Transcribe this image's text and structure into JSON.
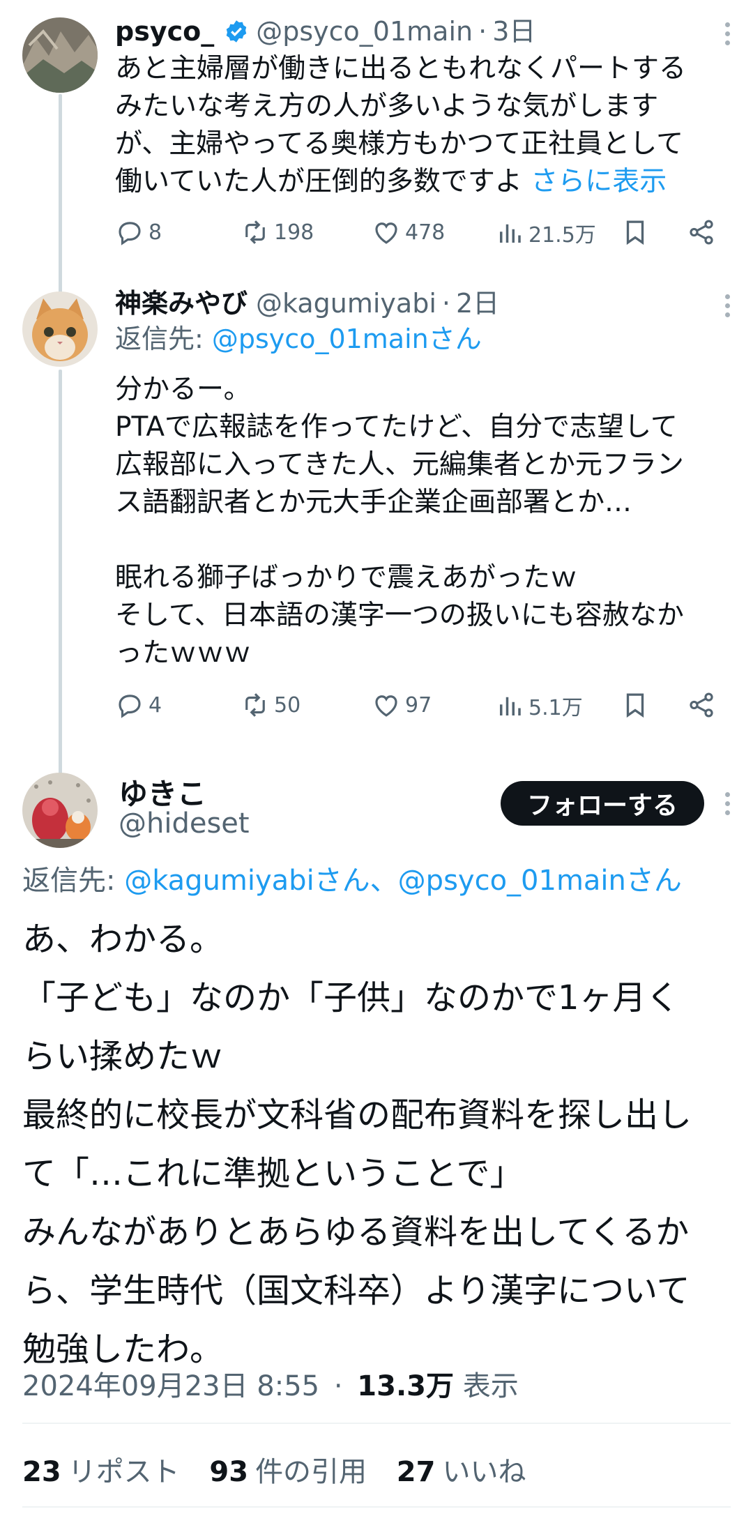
{
  "colors": {
    "link": "#1d9bf0",
    "muted": "#536471",
    "text": "#0f1419",
    "verified": "#1d9bf0"
  },
  "tweets": [
    {
      "name": "psyco_",
      "verified": true,
      "handle": "@psyco_01main",
      "time": "3日",
      "body": "あと主婦層が働きに出るともれなくパートする\nみたいな考え方の人が多いような気がします\nが、主婦やってる奥様方もかつて正社員として\n働いていた人が圧倒的多数ですよ ",
      "show_more": "さらに表示",
      "replies": "8",
      "retweets": "198",
      "likes": "478",
      "views": "21.5万"
    },
    {
      "name": "神楽みやび",
      "handle": "@kagumiyabi",
      "time": "2日",
      "reply_prefix": "返信先: ",
      "reply_to": "@psyco_01mainさん",
      "body": "分かるー。\nPTAで広報誌を作ってたけど、自分で志望して\n広報部に入ってきた人、元編集者とか元フラン\nス語翻訳者とか元大手企業企画部署とか…\n\n眠れる獅子ばっかりで震えあがったｗ\nそして、日本語の漢字一つの扱いにも容赦なか\nったｗｗｗ",
      "replies": "4",
      "retweets": "50",
      "likes": "97",
      "views": "5.1万"
    }
  ],
  "main": {
    "name": "ゆきこ",
    "handle": "@hideset",
    "follow_label": "フォローする",
    "reply_prefix": "返信先: ",
    "reply_to": "@kagumiyabiさん、@psyco_01mainさん",
    "body": "あ、わかる。\n「子ども」なのか「子供」なのかで1ヶ月く\nらい揉めたｗ\n最終的に校長が文科省の配布資料を探し出し\nて「…これに準拠ということで」\nみんながありとあらゆる資料を出してくるか\nら、学生時代（国文科卒）より漢字について\n勉強したわ。",
    "datetime": "2024年09月23日 8:55",
    "views_count": "13.3万",
    "views_label": "表示",
    "reposts_count": "23",
    "reposts_label": "リポスト",
    "quotes_count": "93",
    "quotes_label": "件の引用",
    "likes_count": "27",
    "likes_label": "いいね"
  }
}
